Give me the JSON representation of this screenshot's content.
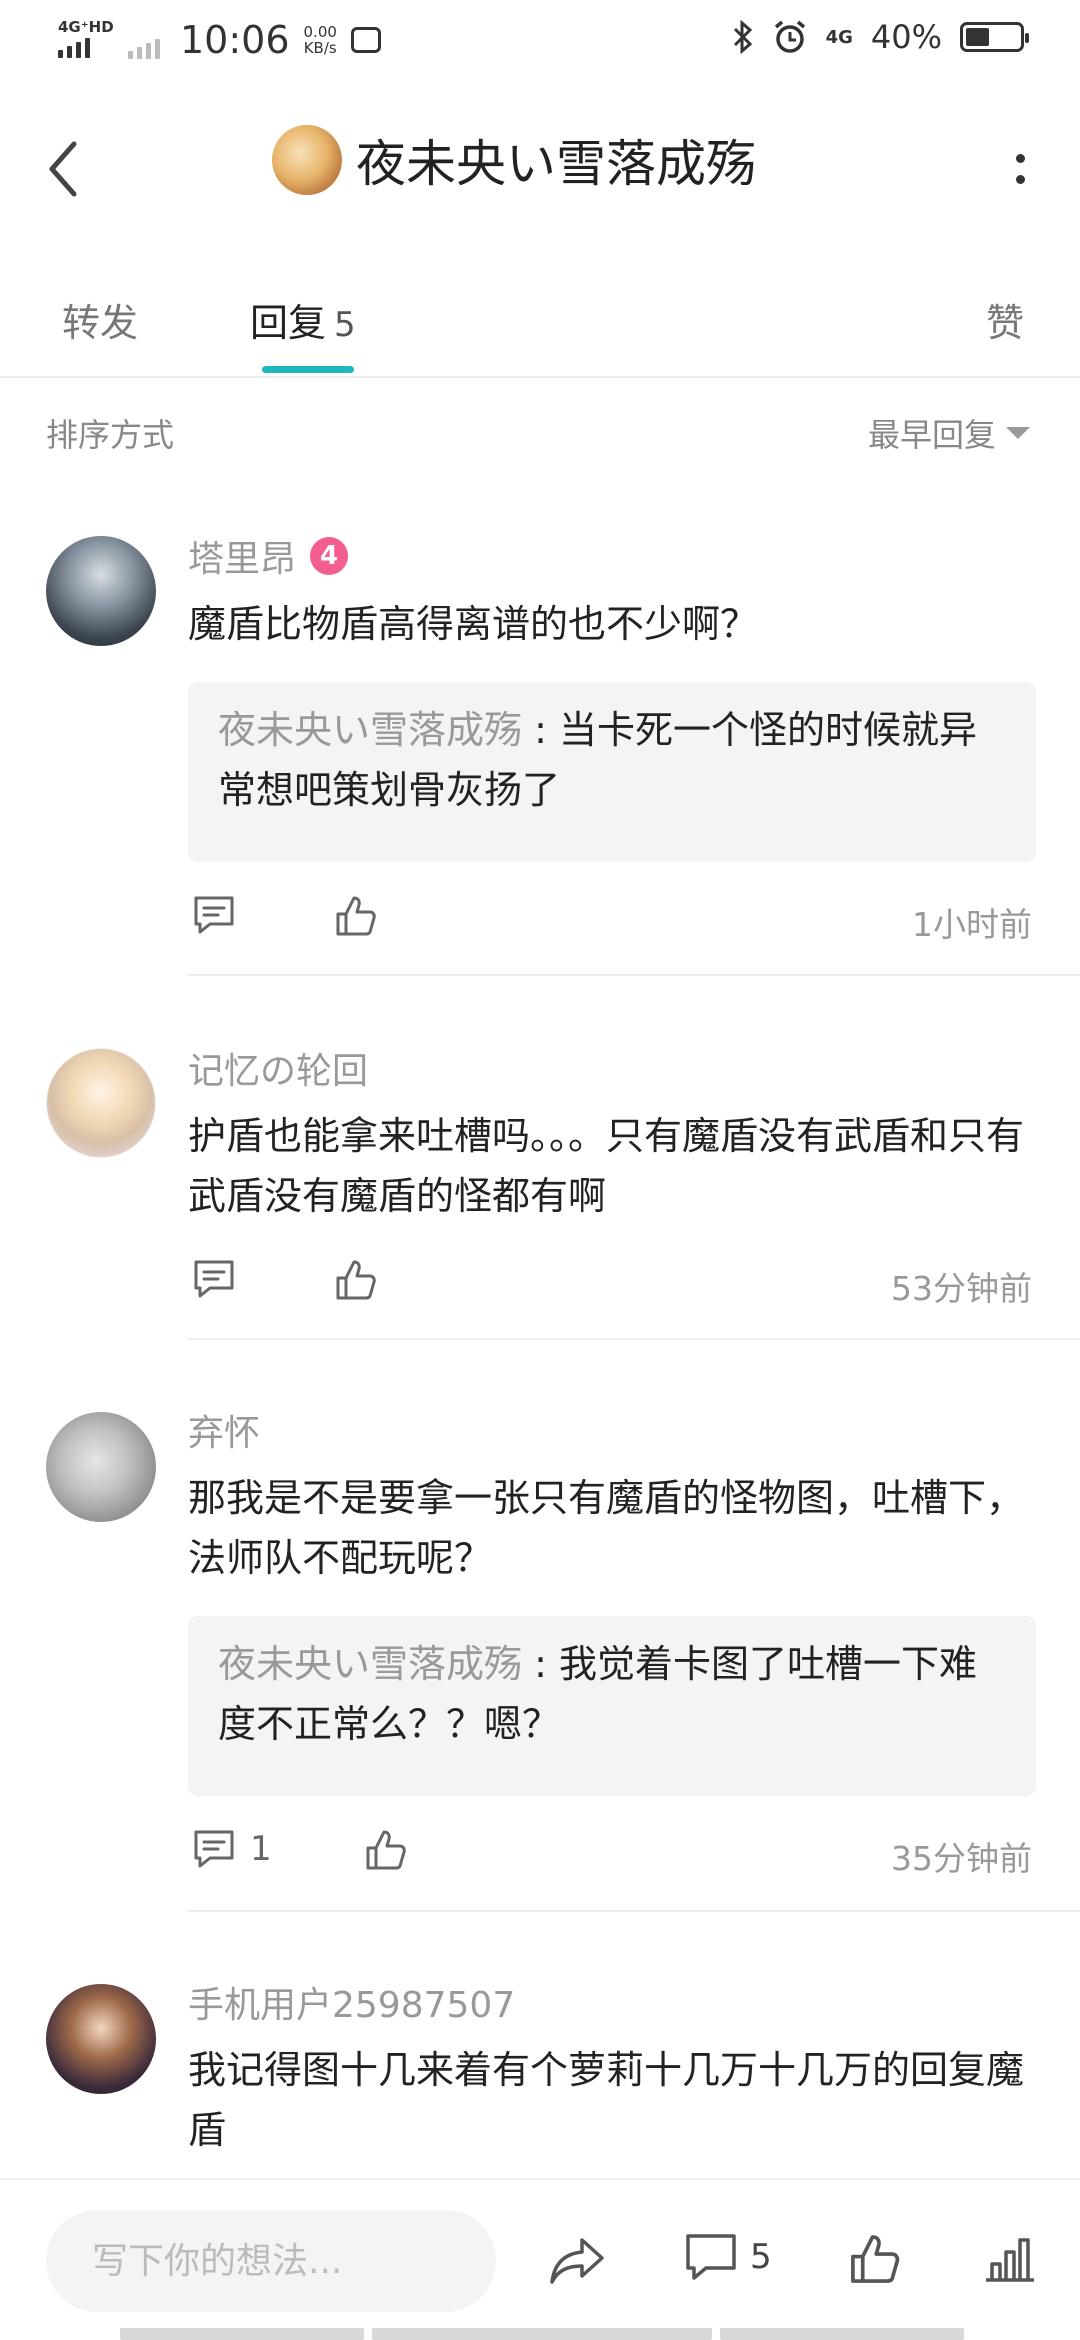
{
  "status_bar": {
    "network_tag": "4G⁺HD",
    "time": "10:06",
    "net_speed_value": "0.00",
    "net_speed_unit": "KB/s",
    "network_right": "4G",
    "battery_text": "40%",
    "battery_level": 0.4,
    "icons": [
      "signal-icon",
      "bluetooth-icon",
      "alarm-icon",
      "battery-icon"
    ]
  },
  "header": {
    "title": "夜未央い雪落成殇",
    "icons": [
      "back-icon",
      "more-icon"
    ]
  },
  "tabs": {
    "forward": "转发",
    "reply": "回复",
    "reply_count": "5",
    "like": "赞"
  },
  "sort": {
    "label": "排序方式",
    "value": "最早回复"
  },
  "comments": [
    {
      "username": "塔里昂",
      "level": "4",
      "text": "魔盾比物盾高得离谱的也不少啊？",
      "quote_author": "夜未央い雪落成殇",
      "quote_text": "当卡死一个怪的时候就异常想吧策划骨灰扬了",
      "reply_count": "",
      "time": "1小时前"
    },
    {
      "username": "记忆の轮回",
      "text": "护盾也能拿来吐槽吗。。。只有魔盾没有武盾和只有武盾没有魔盾的怪都有啊",
      "reply_count": "",
      "time": "53分钟前"
    },
    {
      "username": "弃怀",
      "text": "那我是不是要拿一张只有魔盾的怪物图，吐槽下，法师队不配玩呢？",
      "quote_author": "夜未央い雪落成殇",
      "quote_text": "我觉着卡图了吐槽一下难度不正常么？？嗯？",
      "reply_count": "1",
      "time": "35分钟前"
    },
    {
      "username": "手机用户25987507",
      "text": "我记得图十几来着有个萝莉十几万十几万的回复魔盾"
    }
  ],
  "bottom_bar": {
    "input_placeholder": "写下你的想法...",
    "comment_count": "5",
    "icons": [
      "share-icon",
      "comment-icon",
      "like-icon",
      "stats-icon"
    ]
  },
  "colors": {
    "accent": "#20b8c0",
    "level_badge": "#f25e8e",
    "muted_text": "#999999",
    "quote_bg": "#f4f4f4"
  }
}
